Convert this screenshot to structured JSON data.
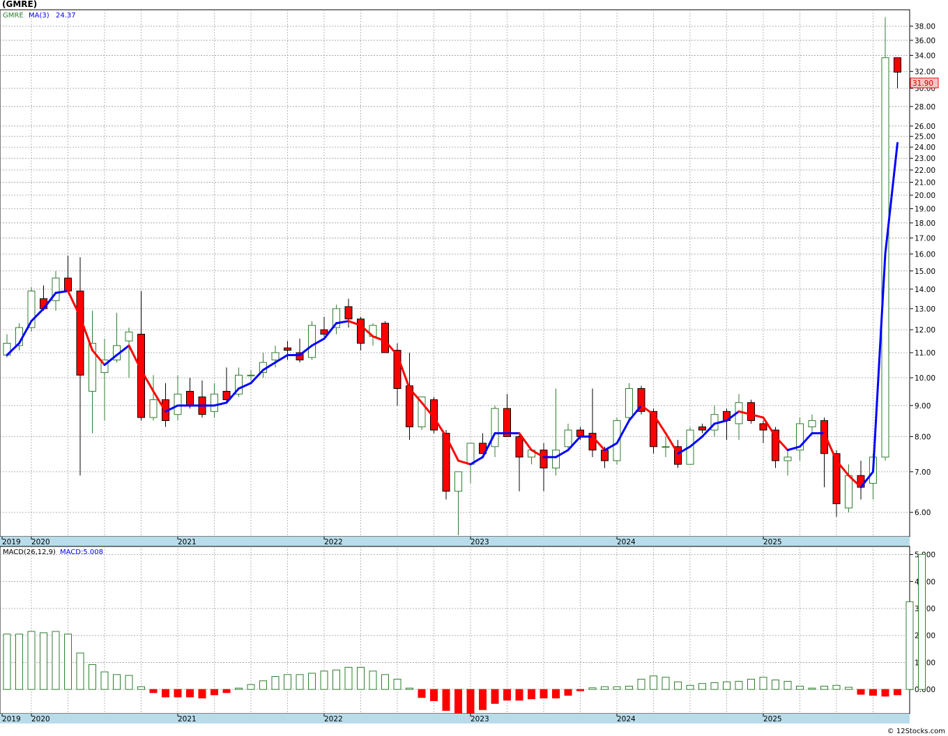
{
  "header": {
    "title": "(GMRE)"
  },
  "price_panel": {
    "legend_symbol": "GMRE",
    "legend_ma": "MA(3)",
    "legend_ma_value": "24.37",
    "last_price_label": "31.90"
  },
  "macd_panel": {
    "legend_label": "MACD(26,12,9)",
    "legend_value": "MACD:5.008"
  },
  "footer": {
    "credit": "© 12Stocks.com"
  },
  "colors": {
    "up": "#2e7d2e",
    "down": "#ff0000",
    "ma_up": "#0000ff",
    "ma_down": "#ff0000",
    "grid": "#9a9a9a",
    "axis_bar": "#b8dcea"
  },
  "chart_data": [
    {
      "type": "candlestick",
      "title": "(GMRE)",
      "scale": "log",
      "ylim": [
        5.5,
        40
      ],
      "y_ticks": [
        "38.00",
        "36.00",
        "34.00",
        "32.00",
        "30.00",
        "28.00",
        "26.00",
        "25.00",
        "24.00",
        "23.00",
        "22.00",
        "21.00",
        "20.00",
        "19.00",
        "18.00",
        "17.00",
        "16.00",
        "15.00",
        "14.00",
        "13.00",
        "12.00",
        "11.00",
        "10.00",
        "9.00",
        "8.00",
        "7.00",
        "6.00"
      ],
      "x_labels": [
        "2019",
        "2020",
        "2021",
        "2022",
        "2023",
        "2024",
        "2025"
      ],
      "ma_period": 3,
      "ma_last": 24.37,
      "last_close": 31.9,
      "grid": true,
      "candles": [
        {
          "d": "2019-11",
          "o": 10.9,
          "h": 11.8,
          "l": 10.8,
          "c": 11.4
        },
        {
          "d": "2019-12",
          "o": 11.3,
          "h": 12.3,
          "l": 11.1,
          "c": 12.1
        },
        {
          "d": "2020-01",
          "o": 12.1,
          "h": 14.1,
          "l": 11.9,
          "c": 13.9
        },
        {
          "d": "2020-02",
          "o": 13.5,
          "h": 14.2,
          "l": 12.9,
          "c": 13.0
        },
        {
          "d": "2020-03",
          "o": 13.4,
          "h": 15.0,
          "l": 12.9,
          "c": 14.6
        },
        {
          "d": "2020-04",
          "o": 14.6,
          "h": 15.9,
          "l": 13.9,
          "c": 13.9
        },
        {
          "d": "2020-05",
          "o": 13.9,
          "h": 15.8,
          "l": 6.9,
          "c": 10.1
        },
        {
          "d": "2020-06",
          "o": 9.5,
          "h": 12.9,
          "l": 8.1,
          "c": 11.4
        },
        {
          "d": "2020-07",
          "o": 10.2,
          "h": 11.6,
          "l": 8.5,
          "c": 10.7
        },
        {
          "d": "2020-08",
          "o": 10.7,
          "h": 12.8,
          "l": 10.6,
          "c": 11.3
        },
        {
          "d": "2020-09",
          "o": 11.5,
          "h": 12.1,
          "l": 10.0,
          "c": 11.9
        },
        {
          "d": "2020-10",
          "o": 11.8,
          "h": 13.9,
          "l": 8.5,
          "c": 8.6
        },
        {
          "d": "2020-11",
          "o": 8.6,
          "h": 10.1,
          "l": 8.5,
          "c": 9.2
        },
        {
          "d": "2020-12",
          "o": 9.2,
          "h": 9.8,
          "l": 8.3,
          "c": 8.5
        },
        {
          "d": "2021-01",
          "o": 8.7,
          "h": 10.1,
          "l": 8.5,
          "c": 9.4
        },
        {
          "d": "2021-02",
          "o": 9.5,
          "h": 10.0,
          "l": 8.9,
          "c": 9.0
        },
        {
          "d": "2021-03",
          "o": 9.3,
          "h": 9.9,
          "l": 8.6,
          "c": 8.7
        },
        {
          "d": "2021-04",
          "o": 8.8,
          "h": 9.8,
          "l": 8.6,
          "c": 9.4
        },
        {
          "d": "2021-05",
          "o": 9.5,
          "h": 10.4,
          "l": 9.1,
          "c": 9.2
        },
        {
          "d": "2021-06",
          "o": 9.4,
          "h": 10.4,
          "l": 9.3,
          "c": 10.1
        },
        {
          "d": "2021-07",
          "o": 10.1,
          "h": 10.3,
          "l": 9.9,
          "c": 10.1
        },
        {
          "d": "2021-08",
          "o": 10.2,
          "h": 11.0,
          "l": 10.0,
          "c": 10.6
        },
        {
          "d": "2021-09",
          "o": 10.7,
          "h": 11.3,
          "l": 10.4,
          "c": 11.0
        },
        {
          "d": "2021-10",
          "o": 11.2,
          "h": 11.5,
          "l": 10.7,
          "c": 11.1
        },
        {
          "d": "2021-11",
          "o": 11.0,
          "h": 11.6,
          "l": 10.6,
          "c": 10.7
        },
        {
          "d": "2021-12",
          "o": 10.8,
          "h": 12.4,
          "l": 10.7,
          "c": 12.2
        },
        {
          "d": "2022-01",
          "o": 12.0,
          "h": 12.6,
          "l": 11.7,
          "c": 11.8
        },
        {
          "d": "2022-02",
          "o": 12.1,
          "h": 13.2,
          "l": 11.8,
          "c": 13.0
        },
        {
          "d": "2022-03",
          "o": 13.1,
          "h": 13.5,
          "l": 12.1,
          "c": 12.5
        },
        {
          "d": "2022-04",
          "o": 12.5,
          "h": 12.6,
          "l": 11.1,
          "c": 11.4
        },
        {
          "d": "2022-05",
          "o": 11.7,
          "h": 12.3,
          "l": 11.3,
          "c": 12.2
        },
        {
          "d": "2022-06",
          "o": 12.3,
          "h": 12.4,
          "l": 11.0,
          "c": 11.0
        },
        {
          "d": "2022-07",
          "o": 11.1,
          "h": 11.4,
          "l": 9.0,
          "c": 9.6
        },
        {
          "d": "2022-08",
          "o": 9.7,
          "h": 11.0,
          "l": 7.9,
          "c": 8.3
        },
        {
          "d": "2022-09",
          "o": 8.3,
          "h": 9.3,
          "l": 8.2,
          "c": 9.3
        },
        {
          "d": "2022-10",
          "o": 9.2,
          "h": 9.3,
          "l": 8.1,
          "c": 8.2
        },
        {
          "d": "2022-11",
          "o": 8.1,
          "h": 8.2,
          "l": 6.3,
          "c": 6.5
        },
        {
          "d": "2022-12",
          "o": 6.5,
          "h": 7.0,
          "l": 5.5,
          "c": 7.0
        },
        {
          "d": "2023-01",
          "o": 7.2,
          "h": 7.8,
          "l": 6.7,
          "c": 7.8
        },
        {
          "d": "2023-02",
          "o": 7.8,
          "h": 8.1,
          "l": 7.5,
          "c": 7.5
        },
        {
          "d": "2023-03",
          "o": 7.7,
          "h": 9.0,
          "l": 7.4,
          "c": 8.9
        },
        {
          "d": "2023-04",
          "o": 8.9,
          "h": 9.4,
          "l": 8.0,
          "c": 8.0
        },
        {
          "d": "2023-05",
          "o": 8.0,
          "h": 8.1,
          "l": 6.5,
          "c": 7.4
        },
        {
          "d": "2023-06",
          "o": 7.4,
          "h": 7.6,
          "l": 7.2,
          "c": 7.6
        },
        {
          "d": "2023-07",
          "o": 7.6,
          "h": 7.8,
          "l": 6.5,
          "c": 7.1
        },
        {
          "d": "2023-08",
          "o": 7.1,
          "h": 9.6,
          "l": 6.9,
          "c": 7.6
        },
        {
          "d": "2023-09",
          "o": 7.7,
          "h": 8.4,
          "l": 7.6,
          "c": 8.2
        },
        {
          "d": "2023-10",
          "o": 8.2,
          "h": 8.3,
          "l": 7.9,
          "c": 8.0
        },
        {
          "d": "2023-11",
          "o": 8.1,
          "h": 9.6,
          "l": 7.4,
          "c": 7.6
        },
        {
          "d": "2023-12",
          "o": 7.6,
          "h": 7.7,
          "l": 7.1,
          "c": 7.3
        },
        {
          "d": "2024-01",
          "o": 7.3,
          "h": 8.6,
          "l": 7.2,
          "c": 8.5
        },
        {
          "d": "2024-02",
          "o": 8.6,
          "h": 9.8,
          "l": 8.5,
          "c": 9.6
        },
        {
          "d": "2024-03",
          "o": 9.6,
          "h": 9.7,
          "l": 8.7,
          "c": 8.8
        },
        {
          "d": "2024-04",
          "o": 8.8,
          "h": 8.9,
          "l": 7.5,
          "c": 7.7
        },
        {
          "d": "2024-05",
          "o": 7.7,
          "h": 8.0,
          "l": 7.4,
          "c": 7.7
        },
        {
          "d": "2024-06",
          "o": 7.7,
          "h": 7.9,
          "l": 7.1,
          "c": 7.2
        },
        {
          "d": "2024-07",
          "o": 7.2,
          "h": 8.3,
          "l": 7.2,
          "c": 8.2
        },
        {
          "d": "2024-08",
          "o": 8.3,
          "h": 8.4,
          "l": 8.1,
          "c": 8.2
        },
        {
          "d": "2024-09",
          "o": 8.2,
          "h": 9.0,
          "l": 8.0,
          "c": 8.7
        },
        {
          "d": "2024-10",
          "o": 8.8,
          "h": 8.9,
          "l": 7.9,
          "c": 8.5
        },
        {
          "d": "2024-11",
          "o": 8.4,
          "h": 9.4,
          "l": 7.9,
          "c": 9.1
        },
        {
          "d": "2024-12",
          "o": 9.1,
          "h": 9.2,
          "l": 8.4,
          "c": 8.5
        },
        {
          "d": "2025-01",
          "o": 8.4,
          "h": 8.5,
          "l": 7.8,
          "c": 8.2
        },
        {
          "d": "2025-02",
          "o": 8.2,
          "h": 8.3,
          "l": 7.1,
          "c": 7.3
        },
        {
          "d": "2025-03",
          "o": 7.3,
          "h": 7.6,
          "l": 6.9,
          "c": 7.4
        },
        {
          "d": "2025-04",
          "o": 7.6,
          "h": 8.6,
          "l": 7.3,
          "c": 8.4
        },
        {
          "d": "2025-05",
          "o": 8.3,
          "h": 8.7,
          "l": 8.1,
          "c": 8.5
        },
        {
          "d": "2025-06",
          "o": 8.5,
          "h": 8.6,
          "l": 6.6,
          "c": 7.5
        },
        {
          "d": "2025-07",
          "o": 7.5,
          "h": 7.6,
          "l": 5.9,
          "c": 6.2
        },
        {
          "d": "2025-08",
          "o": 6.1,
          "h": 7.2,
          "l": 6.0,
          "c": 6.9
        },
        {
          "d": "2025-09",
          "o": 6.9,
          "h": 7.3,
          "l": 6.3,
          "c": 6.6
        },
        {
          "d": "2025-10",
          "o": 6.7,
          "h": 7.5,
          "l": 6.3,
          "c": 7.4
        },
        {
          "d": "2025-11",
          "o": 7.4,
          "h": 39.3,
          "l": 7.3,
          "c": 33.7
        },
        {
          "d": "2025-12",
          "o": 33.7,
          "h": 33.7,
          "l": 30.0,
          "c": 31.9
        }
      ],
      "ma": [
        10.9,
        11.4,
        12.4,
        13.0,
        13.8,
        13.9,
        12.6,
        11.1,
        10.5,
        10.9,
        11.3,
        10.3,
        9.5,
        8.8,
        9.0,
        9.0,
        9.0,
        9.0,
        9.1,
        9.6,
        9.8,
        10.3,
        10.6,
        10.9,
        10.9,
        11.3,
        11.6,
        12.3,
        12.4,
        12.2,
        11.7,
        11.5,
        10.9,
        9.6,
        9.1,
        8.6,
        8.0,
        7.3,
        7.2,
        7.4,
        8.1,
        8.1,
        8.1,
        7.6,
        7.4,
        7.4,
        7.6,
        8.0,
        8.0,
        7.6,
        7.8,
        8.5,
        9.0,
        8.7,
        8.1,
        7.5,
        7.7,
        8.0,
        8.4,
        8.5,
        8.8,
        8.7,
        8.6,
        8.0,
        7.6,
        7.7,
        8.1,
        8.1,
        7.3,
        6.9,
        6.6,
        7.0,
        16.0,
        24.37
      ]
    },
    {
      "type": "bar",
      "title": "MACD(26,12,9)",
      "ylim": [
        -0.9,
        5.3
      ],
      "y_ticks": [
        "5.000",
        "4.000",
        "3.000",
        "2.000",
        "1.000",
        "0.000"
      ],
      "x_labels": [
        "2019",
        "2020",
        "2021",
        "2022",
        "2023",
        "2024",
        "2025"
      ],
      "last_value": 5.008,
      "values": [
        2.05,
        2.05,
        2.15,
        2.1,
        2.15,
        2.05,
        1.35,
        0.92,
        0.65,
        0.55,
        0.52,
        0.1,
        -0.12,
        -0.28,
        -0.28,
        -0.28,
        -0.32,
        -0.2,
        -0.12,
        0.05,
        0.18,
        0.32,
        0.48,
        0.55,
        0.55,
        0.6,
        0.68,
        0.72,
        0.82,
        0.82,
        0.68,
        0.55,
        0.38,
        0.05,
        -0.3,
        -0.42,
        -0.78,
        -0.95,
        -0.88,
        -0.75,
        -0.52,
        -0.4,
        -0.4,
        -0.35,
        -0.32,
        -0.32,
        -0.22,
        -0.05,
        0.06,
        0.1,
        0.1,
        0.12,
        0.38,
        0.5,
        0.45,
        0.28,
        0.15,
        0.22,
        0.25,
        0.28,
        0.3,
        0.38,
        0.45,
        0.35,
        0.3,
        0.12,
        0.05,
        0.12,
        0.15,
        0.08,
        -0.18,
        -0.22,
        -0.25,
        -0.2,
        3.25,
        5.008
      ]
    }
  ]
}
